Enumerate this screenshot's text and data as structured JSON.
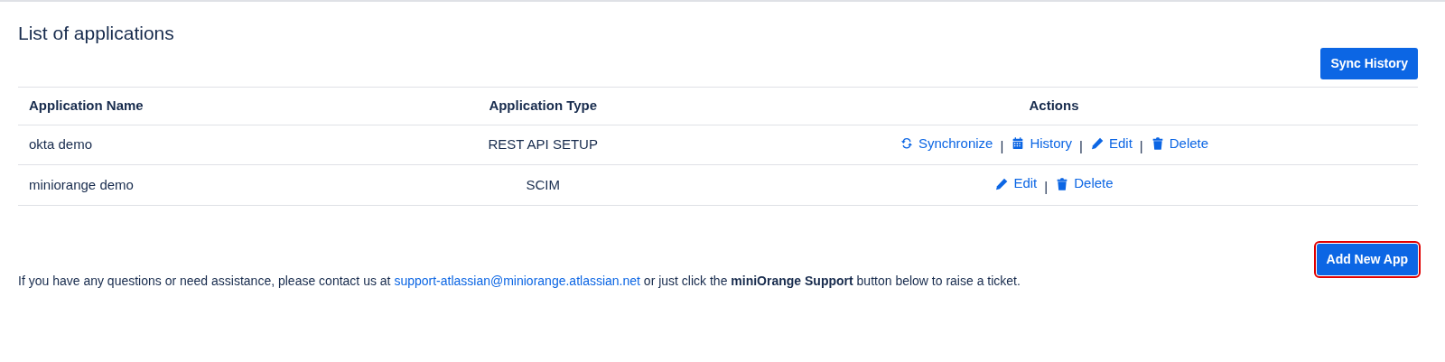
{
  "title": "List of applications",
  "sync_history_button": "Sync History",
  "table": {
    "columns": [
      "Application Name",
      "Application Type",
      "Actions"
    ],
    "rows": [
      {
        "name": "okta demo",
        "type": "REST API SETUP",
        "actions": [
          {
            "kind": "sync",
            "label": "Synchronize"
          },
          {
            "kind": "history",
            "label": "History",
            "separator": "|"
          },
          {
            "kind": "edit",
            "label": "Edit",
            "separator": "|"
          },
          {
            "kind": "delete",
            "label": "Delete",
            "separator": "|"
          }
        ]
      },
      {
        "name": "miniorange demo",
        "type": "SCIM",
        "actions": [
          {
            "kind": "edit",
            "label": "Edit"
          },
          {
            "kind": "delete",
            "label": "Delete",
            "separator": "|"
          }
        ]
      }
    ]
  },
  "add_button": {
    "label": "Add New App",
    "highlighted": true
  },
  "help": {
    "before": "If you have any questions or need assistance, please contact us at",
    "link": "support-atlassian@miniorange.atlassian.net",
    "after": "or just click the **miniOrange Support** button below to raise a ticket."
  }
}
